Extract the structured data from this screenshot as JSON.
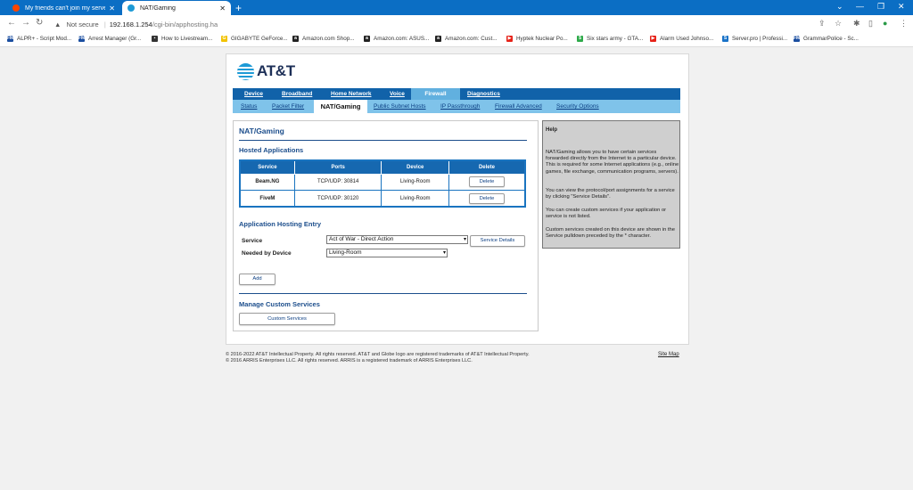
{
  "browser": {
    "tabs": [
      {
        "title": "My friends can't join my server -",
        "active": false
      },
      {
        "title": "NAT/Gaming",
        "active": true
      }
    ],
    "security_label": "Not secure",
    "url_host": "192.168.1.254",
    "url_path": "/cgi-bin/apphosting.ha",
    "bookmarks": [
      {
        "label": "ALPR+ - Script Mod...",
        "icon": "fm-icon",
        "color": "#1b4ea0",
        "glyph": "FM"
      },
      {
        "label": "Arrest Manager (Gr...",
        "icon": "fm-icon",
        "color": "#1b4ea0",
        "glyph": "FM"
      },
      {
        "label": "How to Livestream...",
        "icon": "page-icon",
        "color": "#333333",
        "glyph": "▪"
      },
      {
        "label": "GIGABYTE GeForce...",
        "icon": "gigabyte-icon",
        "color": "#f2c300",
        "glyph": "G"
      },
      {
        "label": "Amazon.com Shop...",
        "icon": "amazon-icon",
        "color": "#222222",
        "glyph": "a"
      },
      {
        "label": "Amazon.com: ASUS...",
        "icon": "amazon-icon",
        "color": "#222222",
        "glyph": "a"
      },
      {
        "label": "Amazon.com: Cust...",
        "icon": "amazon-icon",
        "color": "#222222",
        "glyph": "a"
      },
      {
        "label": "Hyptek Nuclear Po...",
        "icon": "youtube-icon",
        "color": "#e62117",
        "glyph": "▶"
      },
      {
        "label": "Six stars army - GTA...",
        "icon": "green-circle-icon",
        "color": "#2eaa4a",
        "glyph": "$"
      },
      {
        "label": "Alarm Used Johnso...",
        "icon": "youtube-icon",
        "color": "#e62117",
        "glyph": "▶"
      },
      {
        "label": "Server.pro | Professi...",
        "icon": "serverpro-icon",
        "color": "#1a73c8",
        "glyph": "S"
      },
      {
        "label": "GrammarPolice - Sc...",
        "icon": "fm-icon",
        "color": "#1b4ea0",
        "glyph": "FM"
      }
    ]
  },
  "brand": "AT&T",
  "main_nav": [
    "Device",
    "Broadband",
    "Home Network",
    "Voice",
    "Firewall",
    "Diagnostics"
  ],
  "main_nav_selected": "Firewall",
  "sub_nav": [
    "Status",
    "Packet Filter",
    "NAT/Gaming",
    "Public Subnet Hosts",
    "IP Passthrough",
    "Firewall Advanced",
    "Security Options"
  ],
  "sub_nav_selected": "NAT/Gaming",
  "page": {
    "title": "NAT/Gaming",
    "hosted_heading": "Hosted Applications",
    "table_headers": [
      "Service",
      "Ports",
      "Device",
      "Delete"
    ],
    "rows": [
      {
        "service": "Beam.NG",
        "ports": "TCP/UDP: 30814",
        "device": "Living-Room",
        "action": "Delete"
      },
      {
        "service": "FiveM",
        "ports": "TCP/UDP: 30120",
        "device": "Living-Room",
        "action": "Delete"
      }
    ],
    "entry_heading": "Application Hosting Entry",
    "service_label": "Service",
    "service_value": "Act of War - Direct Action",
    "service_details_label": "Service Details",
    "needed_label": "Needed by Device",
    "needed_value": "Living-Room",
    "add_label": "Add",
    "custom_heading": "Manage Custom Services",
    "custom_button_label": "Custom Services"
  },
  "help": {
    "title": "Help",
    "paragraphs": [
      "NAT/Gaming allows you to have certain services forwarded directly from the Internet to a particular device. This is required for some Internet applications (e.g., online games, file exchange, communication programs, servers).",
      "You can view the protocol/port assignments for a service by clicking \"Service Details\".",
      "You can create custom services if your application or service is not listed.",
      "Custom services created on this device are shown in the Service pulldown preceded by the * character."
    ]
  },
  "footer": {
    "line1": "© 2016-2022 AT&T Intellectual Property. All rights reserved. AT&T and Globe logo are registered trademarks of AT&T Intellectual Property.",
    "line2": "© 2016 ARRIS Enterprises LLC. All rights reserved. ARRIS is a registered trademark of ARRIS Enterprises LLC.",
    "sitemap": "Site Map"
  },
  "colors": {
    "nav_dark": "#1162a9",
    "nav_light": "#7fc3ea",
    "heading_blue": "#1c4e8c",
    "chrome_blue": "#0b6ec4"
  }
}
